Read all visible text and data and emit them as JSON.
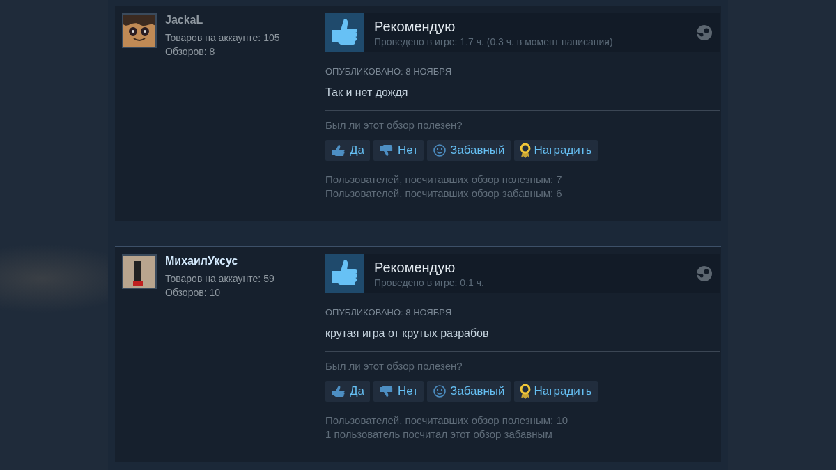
{
  "reviews": [
    {
      "author": {
        "name": "JackaL",
        "online": false,
        "products": "Товаров на аккаунте: 105",
        "reviews": "Обзоров: 8",
        "avatar": {
          "kind": "cartoon"
        }
      },
      "verdict": "Рекомендую",
      "hours": "Проведено в игре: 1.7 ч. (0.3 ч. в момент написания)",
      "posted": "ОПУБЛИКОВАНО: 8 НОЯБРЯ",
      "text": "Так и нет дождя",
      "question": "Был ли этот обзор полезен?",
      "buttons": [
        {
          "kind": "yes",
          "label": "Да"
        },
        {
          "kind": "no",
          "label": "Нет"
        },
        {
          "kind": "funny",
          "label": "Забавный"
        },
        {
          "kind": "award",
          "label": "Наградить"
        }
      ],
      "stats": [
        "Пользователей, посчитавших обзор полезным: 7",
        "Пользователей, посчитавших обзор забавным: 6"
      ]
    },
    {
      "author": {
        "name": "МихаилУксус",
        "online": true,
        "products": "Товаров на аккаунте: 59",
        "reviews": "Обзоров: 10",
        "avatar": {
          "kind": "photo"
        }
      },
      "verdict": "Рекомендую",
      "hours": "Проведено в игре: 0.1 ч.",
      "posted": "ОПУБЛИКОВАНО: 8 НОЯБРЯ",
      "text": "крутая игра от крутых разрабов",
      "question": "Был ли этот обзор полезен?",
      "buttons": [
        {
          "kind": "yes",
          "label": "Да"
        },
        {
          "kind": "no",
          "label": "Нет"
        },
        {
          "kind": "funny",
          "label": "Забавный"
        },
        {
          "kind": "award",
          "label": "Наградить"
        }
      ],
      "stats": [
        "Пользователей, посчитавших обзор полезным: 10",
        "1 пользователь посчитал этот обзор забавным"
      ]
    }
  ]
}
